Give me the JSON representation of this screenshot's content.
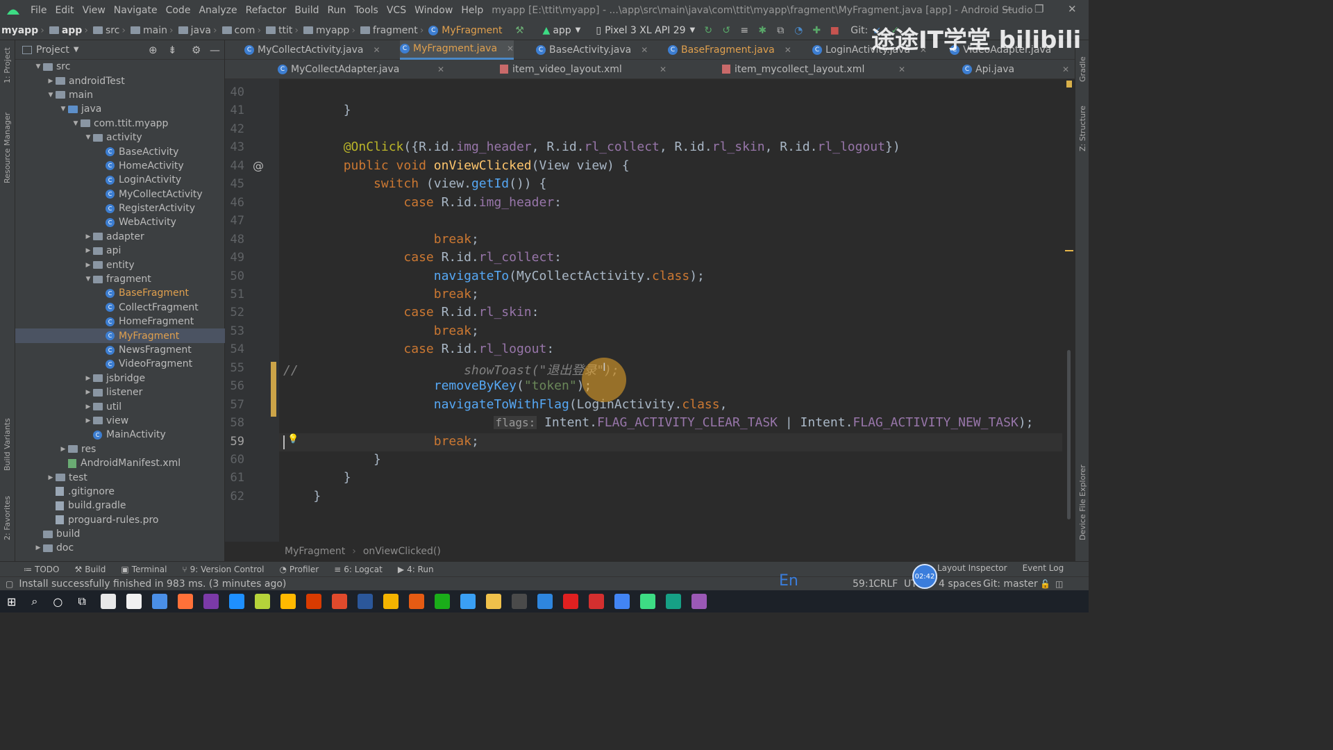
{
  "window": {
    "title": "myapp [E:\\ttit\\myapp] - ...\\app\\src\\main\\java\\com\\ttit\\myapp\\fragment\\MyFragment.java [app] - Android Studio",
    "controls": [
      "—",
      "❐",
      "✕"
    ]
  },
  "menu": [
    "File",
    "Edit",
    "View",
    "Navigate",
    "Code",
    "Analyze",
    "Refactor",
    "Build",
    "Run",
    "Tools",
    "VCS",
    "Window",
    "Help"
  ],
  "breadcrumb": [
    "myapp",
    "app",
    "src",
    "main",
    "java",
    "com",
    "ttit",
    "myapp",
    "fragment",
    "MyFragment"
  ],
  "toolbar": {
    "run_config": "app",
    "device": "Pixel 3 XL API 29",
    "git_label": "Git:"
  },
  "project_panel": {
    "title": "Project",
    "tree": [
      {
        "label": "src",
        "depth": 0,
        "type": "folder",
        "expanded": true
      },
      {
        "label": "androidTest",
        "depth": 1,
        "type": "folder",
        "expanded": false
      },
      {
        "label": "main",
        "depth": 1,
        "type": "folder",
        "expanded": true
      },
      {
        "label": "java",
        "depth": 2,
        "type": "folder-blue",
        "expanded": true
      },
      {
        "label": "com.ttit.myapp",
        "depth": 3,
        "type": "folder",
        "expanded": true
      },
      {
        "label": "activity",
        "depth": 4,
        "type": "folder",
        "expanded": true
      },
      {
        "label": "BaseActivity",
        "depth": 5,
        "type": "class"
      },
      {
        "label": "HomeActivity",
        "depth": 5,
        "type": "class"
      },
      {
        "label": "LoginActivity",
        "depth": 5,
        "type": "class"
      },
      {
        "label": "MyCollectActivity",
        "depth": 5,
        "type": "class"
      },
      {
        "label": "RegisterActivity",
        "depth": 5,
        "type": "class"
      },
      {
        "label": "WebActivity",
        "depth": 5,
        "type": "class"
      },
      {
        "label": "adapter",
        "depth": 4,
        "type": "folder",
        "expanded": false
      },
      {
        "label": "api",
        "depth": 4,
        "type": "folder",
        "expanded": false
      },
      {
        "label": "entity",
        "depth": 4,
        "type": "folder",
        "expanded": false
      },
      {
        "label": "fragment",
        "depth": 4,
        "type": "folder",
        "expanded": true
      },
      {
        "label": "BaseFragment",
        "depth": 5,
        "type": "class",
        "modified": true
      },
      {
        "label": "CollectFragment",
        "depth": 5,
        "type": "class"
      },
      {
        "label": "HomeFragment",
        "depth": 5,
        "type": "class"
      },
      {
        "label": "MyFragment",
        "depth": 5,
        "type": "class",
        "modified": true,
        "selected": true
      },
      {
        "label": "NewsFragment",
        "depth": 5,
        "type": "class"
      },
      {
        "label": "VideoFragment",
        "depth": 5,
        "type": "class"
      },
      {
        "label": "jsbridge",
        "depth": 4,
        "type": "folder",
        "expanded": false
      },
      {
        "label": "listener",
        "depth": 4,
        "type": "folder",
        "expanded": false
      },
      {
        "label": "util",
        "depth": 4,
        "type": "folder",
        "expanded": false
      },
      {
        "label": "view",
        "depth": 4,
        "type": "folder",
        "expanded": false
      },
      {
        "label": "MainActivity",
        "depth": 4,
        "type": "class"
      },
      {
        "label": "res",
        "depth": 2,
        "type": "folder",
        "expanded": false
      },
      {
        "label": "AndroidManifest.xml",
        "depth": 2,
        "type": "manifest"
      },
      {
        "label": "test",
        "depth": 1,
        "type": "folder",
        "expanded": false
      },
      {
        "label": ".gitignore",
        "depth": 1,
        "type": "file"
      },
      {
        "label": "build.gradle",
        "depth": 1,
        "type": "file"
      },
      {
        "label": "proguard-rules.pro",
        "depth": 1,
        "type": "file"
      },
      {
        "label": "build",
        "depth": 0,
        "type": "folder"
      },
      {
        "label": "doc",
        "depth": 0,
        "type": "folder",
        "expanded": false
      }
    ]
  },
  "tabs_row1": [
    {
      "label": "MyCollectActivity.java",
      "active": false
    },
    {
      "label": "MyFragment.java",
      "active": true,
      "modified": true
    },
    {
      "label": "BaseActivity.java",
      "active": false
    },
    {
      "label": "BaseFragment.java",
      "active": false,
      "modified": true
    },
    {
      "label": "LoginActivity.java",
      "active": false
    },
    {
      "label": "VideoAdapter.java",
      "active": false
    }
  ],
  "tabs_row2": [
    {
      "label": "MyCollectAdapter.java",
      "type": "java"
    },
    {
      "label": "item_video_layout.xml",
      "type": "xml"
    },
    {
      "label": "item_mycollect_layout.xml",
      "type": "xml"
    },
    {
      "label": "Api.java",
      "type": "java"
    }
  ],
  "editor": {
    "lines": [
      {
        "n": "40",
        "html": ""
      },
      {
        "n": "41",
        "html": "        }"
      },
      {
        "n": "42",
        "html": ""
      },
      {
        "n": "43",
        "html": "        <span class='ann'>@OnClick</span>({R.id.<span class='fld'>img_header</span>, R.id.<span class='fld'>rl_collect</span>, R.id.<span class='fld'>rl_skin</span>, R.id.<span class='fld'>rl_logout</span>})"
      },
      {
        "n": "44",
        "html": "        <span class='kw'>public void</span> <span class='fn'>onViewClicked</span>(View view) {"
      },
      {
        "n": "45",
        "html": "            <span class='kw'>switch</span> (view.<span class='call'>getId</span>()) {"
      },
      {
        "n": "46",
        "html": "                <span class='kw'>case</span> R.id.<span class='fld'>img_header</span>:"
      },
      {
        "n": "47",
        "html": ""
      },
      {
        "n": "48",
        "html": "                    <span class='kw'>break</span>;"
      },
      {
        "n": "49",
        "html": "                <span class='kw'>case</span> R.id.<span class='fld'>rl_collect</span>:"
      },
      {
        "n": "50",
        "html": "                    <span class='call'>navigateTo</span>(MyCollectActivity.<span class='kw'>class</span>);"
      },
      {
        "n": "51",
        "html": "                    <span class='kw'>break</span>;"
      },
      {
        "n": "52",
        "html": "                <span class='kw'>case</span> R.id.<span class='fld'>rl_skin</span>:"
      },
      {
        "n": "53",
        "html": "                    <span class='kw'>break</span>;"
      },
      {
        "n": "54",
        "html": "                <span class='kw'>case</span> R.id.<span class='fld'>rl_logout</span>:"
      },
      {
        "n": "55",
        "html": "<span class='cmt'>//                      showToast(\"退出登录\");</span>"
      },
      {
        "n": "56",
        "html": "                    <span class='call'>removeByKey</span>(<span class='str'>\"token\"</span>);"
      },
      {
        "n": "57",
        "html": "                    <span class='call'>navigateToWithFlag</span>(LoginActivity.<span class='kw'>class</span>,"
      },
      {
        "n": "58",
        "html": "                            <span class='hint'>flags:</span> Intent.<span class='fld'>FLAG_ACTIVITY_CLEAR_TASK</span> | Intent.<span class='fld'>FLAG_ACTIVITY_NEW_TASK</span>);"
      },
      {
        "n": "59",
        "html": "                    <span class='kw'>break</span>;"
      },
      {
        "n": "60",
        "html": "            }"
      },
      {
        "n": "61",
        "html": "        }"
      },
      {
        "n": "62",
        "html": "    }"
      }
    ],
    "current_line": "59"
  },
  "editor_breadcrumb": [
    "MyFragment",
    "onViewClicked()"
  ],
  "bottom_tools": [
    "TODO",
    "Build",
    "Terminal",
    "9: Version Control",
    "Profiler",
    "6: Logcat",
    "4: Run"
  ],
  "bottom_right_tools": [
    "Layout Inspector",
    "Event Log"
  ],
  "left_strip": [
    "1: Project",
    "Resource Manager",
    "Build Variants",
    "2: Favorites"
  ],
  "right_strip": [
    "Gradle",
    "Z: Structure",
    "Device File Explorer"
  ],
  "status": {
    "message": "Install successfully finished in 983 ms. (3 minutes ago)",
    "position": "59:1",
    "line_sep": "CRLF",
    "encoding": "UTF-8",
    "indent": "4 spaces",
    "git": "Git: master",
    "timer": "02:42",
    "ime": "En"
  },
  "watermark": "途途IT学堂 bilibili"
}
